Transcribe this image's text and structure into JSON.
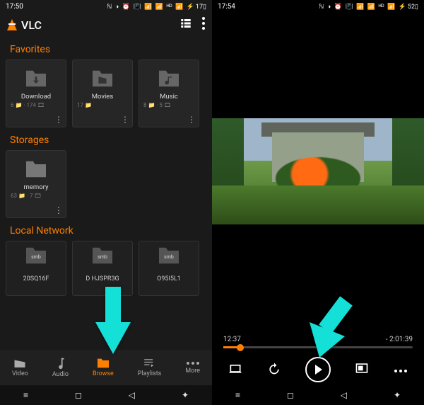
{
  "left": {
    "status_time": "17:50",
    "status_batt": "17",
    "app_title": "VLC",
    "sections": {
      "favorites": "Favorites",
      "storages": "Storages",
      "local_network": "Local Network"
    },
    "fav_tiles": [
      {
        "label": "Download",
        "sub": "6 📁 · 174 🎞"
      },
      {
        "label": "Movies",
        "sub": "17 📁"
      },
      {
        "label": "Music",
        "sub": "8 📁 · 5 🎞"
      }
    ],
    "storage_tiles": [
      {
        "label": "memory",
        "sub": "63 📁 · 7 🎞"
      }
    ],
    "lan_tiles": [
      {
        "label": "20SQ16F",
        "badge": "smb"
      },
      {
        "label": "D      HJSPR3G",
        "badge": "smb"
      },
      {
        "label": "O95I5L1",
        "badge": "smb"
      }
    ],
    "nav": {
      "video": "Video",
      "audio": "Audio",
      "browse": "Browse",
      "playlists": "Playlists",
      "more": "More"
    }
  },
  "right": {
    "status_time": "17:54",
    "status_batt": "52",
    "elapsed": "12:37",
    "remaining": "- 2:01:39"
  },
  "colors": {
    "accent": "#ff7f00",
    "arrow": "#14e0d8"
  }
}
